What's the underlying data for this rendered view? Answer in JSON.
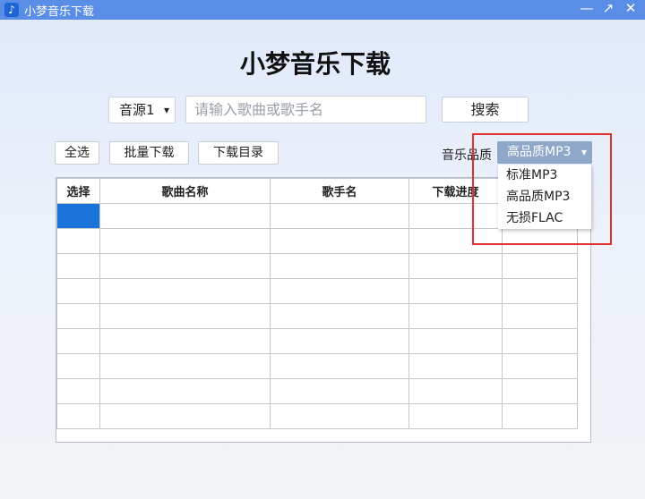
{
  "window": {
    "title": "小梦音乐下载",
    "minimize": "—",
    "maximize": "↗",
    "close": "✕"
  },
  "heading": "小梦音乐下载",
  "search": {
    "source": "音源1",
    "placeholder": "请输入歌曲或歌手名",
    "button": "搜索"
  },
  "toolbar": {
    "select_all": "全选",
    "batch_download": "批量下载",
    "download_dir": "下载目录"
  },
  "quality": {
    "label": "音乐品质",
    "selected": "高品质MP3",
    "options": [
      "标准MP3",
      "高品质MP3",
      "无损FLAC"
    ]
  },
  "table": {
    "headers": [
      "选择",
      "歌曲名称",
      "歌手名",
      "下载进度",
      ""
    ],
    "row_count": 9
  },
  "colors": {
    "titlebar": "#5a8ee6",
    "selection": "#1a73d9",
    "highlight": "#e0312e"
  }
}
